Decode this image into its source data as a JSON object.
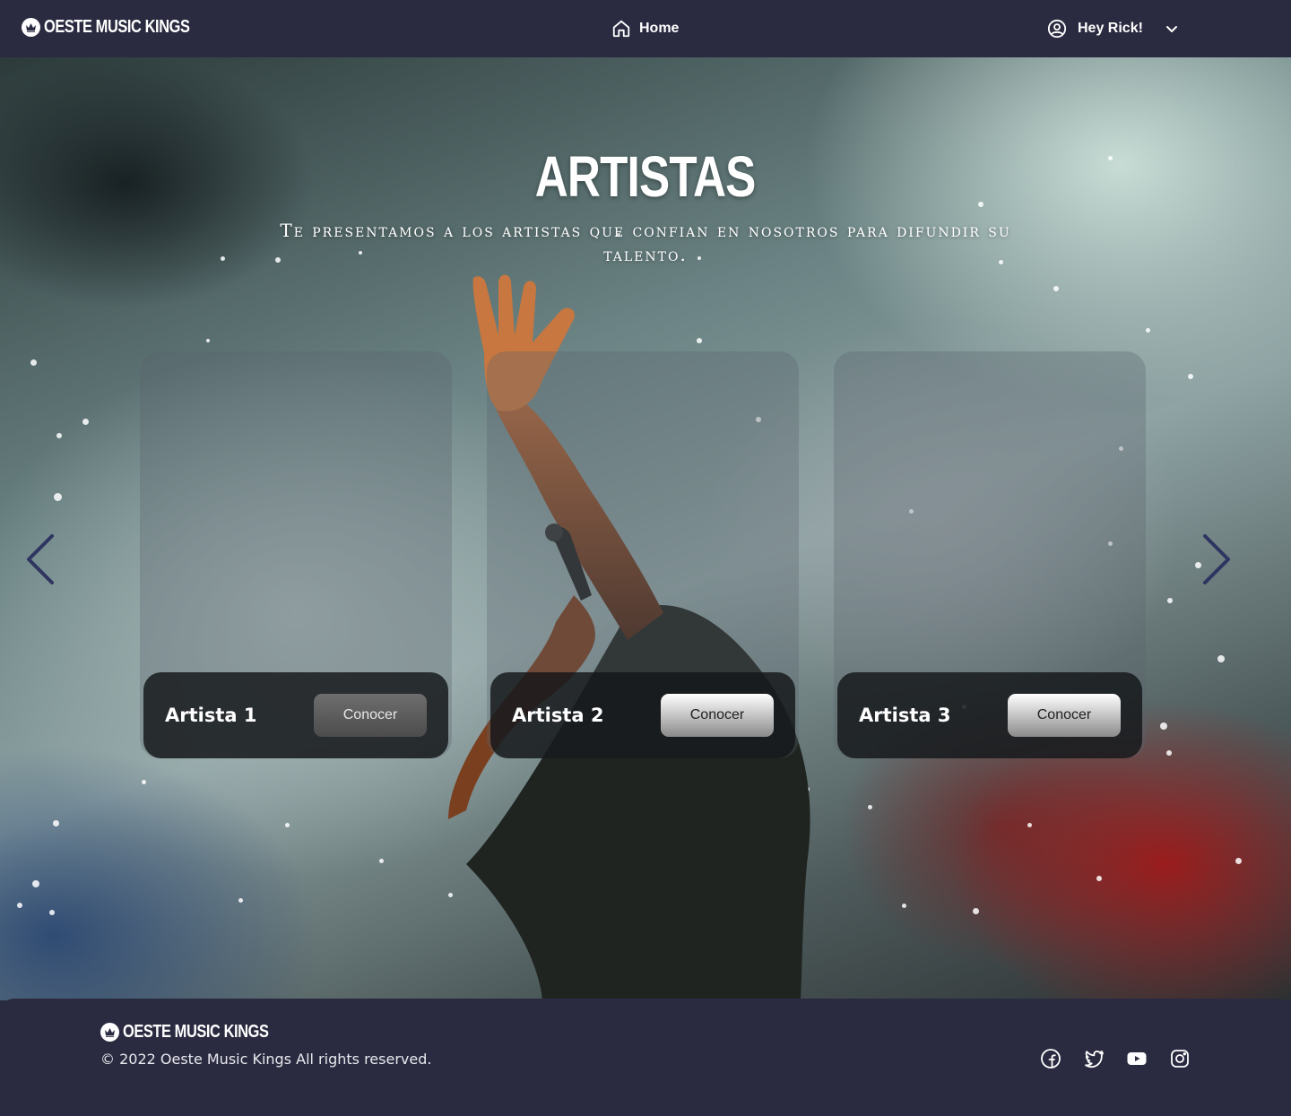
{
  "header": {
    "brand": "OESTE MUSIC KINGS",
    "home_label": "Home",
    "user_greeting": "Hey Rick!"
  },
  "hero": {
    "title": "ARTISTAS",
    "subtitle": "Te presentamos a los artistas que confian en nosotros para difundir su talento."
  },
  "artists": [
    {
      "name": "Artista 1",
      "button": "Conocer"
    },
    {
      "name": "Artista 2",
      "button": "Conocer"
    },
    {
      "name": "Artista 3",
      "button": "Conocer"
    }
  ],
  "footer": {
    "brand": "OESTE MUSIC KINGS",
    "copyright": "© 2022 Oeste Music Kings All rights reserved.",
    "social": [
      "facebook-icon",
      "twitter-icon",
      "youtube-icon",
      "instagram-icon"
    ]
  },
  "colors": {
    "nav_background": "#2a2b40",
    "card_footer": "#141618",
    "arrow": "#2e3560"
  }
}
